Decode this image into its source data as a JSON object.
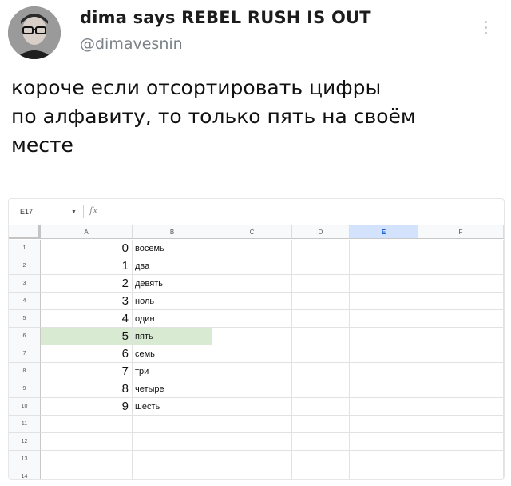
{
  "tweet": {
    "display_name": "dima says REBEL RUSH IS OUT",
    "handle": "@dimavesnin",
    "text_lines": [
      "короче если отсортировать цифры",
      "по алфавиту, то только пять на своём",
      "месте"
    ]
  },
  "spreadsheet": {
    "name_box": "E17",
    "fx_label": "fx",
    "formula": "",
    "columns": [
      "A",
      "B",
      "C",
      "D",
      "E",
      "F"
    ],
    "active_column": "E",
    "row_numbers": [
      "1",
      "2",
      "3",
      "4",
      "5",
      "6",
      "7",
      "8",
      "9",
      "10",
      "11",
      "12",
      "13",
      "14"
    ],
    "rows": [
      {
        "num": "0",
        "word": "восемь"
      },
      {
        "num": "1",
        "word": "два"
      },
      {
        "num": "2",
        "word": "девять"
      },
      {
        "num": "3",
        "word": "ноль"
      },
      {
        "num": "4",
        "word": "один"
      },
      {
        "num": "5",
        "word": "пять"
      },
      {
        "num": "6",
        "word": "семь"
      },
      {
        "num": "7",
        "word": "три"
      },
      {
        "num": "8",
        "word": "четыре"
      },
      {
        "num": "9",
        "word": "шесть"
      }
    ],
    "highlighted_row": 6,
    "highlight_color": "#d9ead3",
    "active_header_color": "#d3e3fd"
  }
}
